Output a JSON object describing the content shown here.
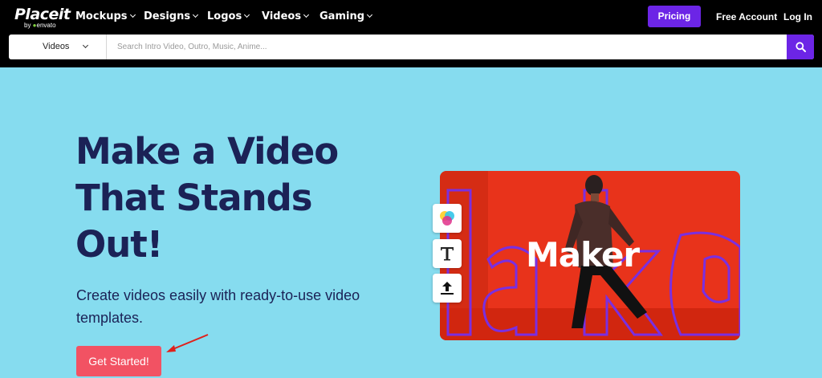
{
  "logo": {
    "main": "Placeit",
    "sub_prefix": "by ",
    "sub_brand": "envato"
  },
  "nav": {
    "items": [
      {
        "label": "Mockups"
      },
      {
        "label": "Designs"
      },
      {
        "label": "Logos"
      },
      {
        "label": "Videos"
      },
      {
        "label": "Gaming"
      }
    ],
    "pricing": "Pricing",
    "free_account": "Free Account",
    "login": "Log In"
  },
  "search": {
    "category": "Videos",
    "placeholder": "Search Intro Video, Outro, Music, Anime...",
    "value": ""
  },
  "hero": {
    "title_line1": "Make a Video",
    "title_line2": "That Stands",
    "title_line3": "Out!",
    "subtitle_line1": "Create videos easily with ready-to-use video",
    "subtitle_line2": "templates.",
    "cta": "Get Started!"
  },
  "preview": {
    "overlay_text": "Maker",
    "outline_text": "lake",
    "tools": [
      "color-palette-icon",
      "text-tool-icon",
      "upload-icon"
    ]
  },
  "colors": {
    "topbar": "#000000",
    "accent": "#6c25e6",
    "hero_bg": "#86dcef",
    "heading": "#1b2256",
    "cta": "#f25263",
    "card_bg": "#e8331b",
    "annotation_arrow": "#e0201a"
  }
}
